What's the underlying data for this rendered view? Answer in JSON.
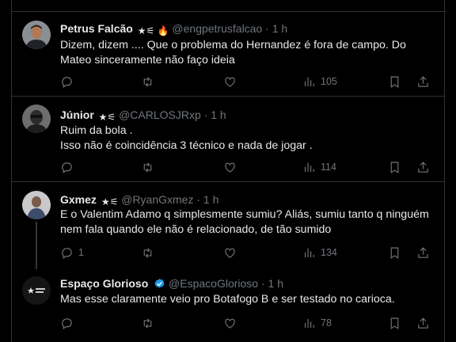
{
  "tweets": [
    {
      "name": "Petrus Falcão",
      "badge": "★⚟ 🔥",
      "handle": "@engpetrusfalcao",
      "sep": "·",
      "time": "1 h",
      "text": "Dizem, dizem .... Que o problema do Hernandez é fora de campo. Do Mateo sinceramente não faço ideia",
      "replies": "",
      "views": "105"
    },
    {
      "name": "Júnior",
      "badge": "★⚟",
      "handle": "@CARLOSJRxp",
      "sep": "·",
      "time": "1 h",
      "text": "Ruim da bola .\nIsso não é coincidência 3 técnico e nada de jogar .",
      "replies": "",
      "views": "114"
    },
    {
      "name": "Gxmez",
      "badge": "★⚟",
      "handle": "@RyanGxmez",
      "sep": "·",
      "time": "1 h",
      "text": "E o Valentim Adamo q simplesmente sumiu? Aliás, sumiu tanto q ninguém nem fala quando ele não é relacionado, de tão sumido",
      "replies": "1",
      "views": "134"
    },
    {
      "name": "Espaço Glorioso",
      "badge": "",
      "handle": "@EspacoGlorioso",
      "sep": "·",
      "time": "1 h",
      "text": "Mas esse claramente veio pro Botafogo B e ser testado no carioca.",
      "replies": "",
      "views": "78"
    }
  ],
  "icons": {
    "reply": "reply-icon",
    "retweet": "retweet-icon",
    "like": "like-icon",
    "views": "views-icon",
    "bookmark": "bookmark-icon",
    "share": "share-icon",
    "verified": "verified-badge-icon"
  },
  "colors": {
    "background": "#000000",
    "text": "#e7e9ea",
    "muted": "#71767b",
    "verified": "#1d9bf0",
    "border": "#2f3336"
  }
}
